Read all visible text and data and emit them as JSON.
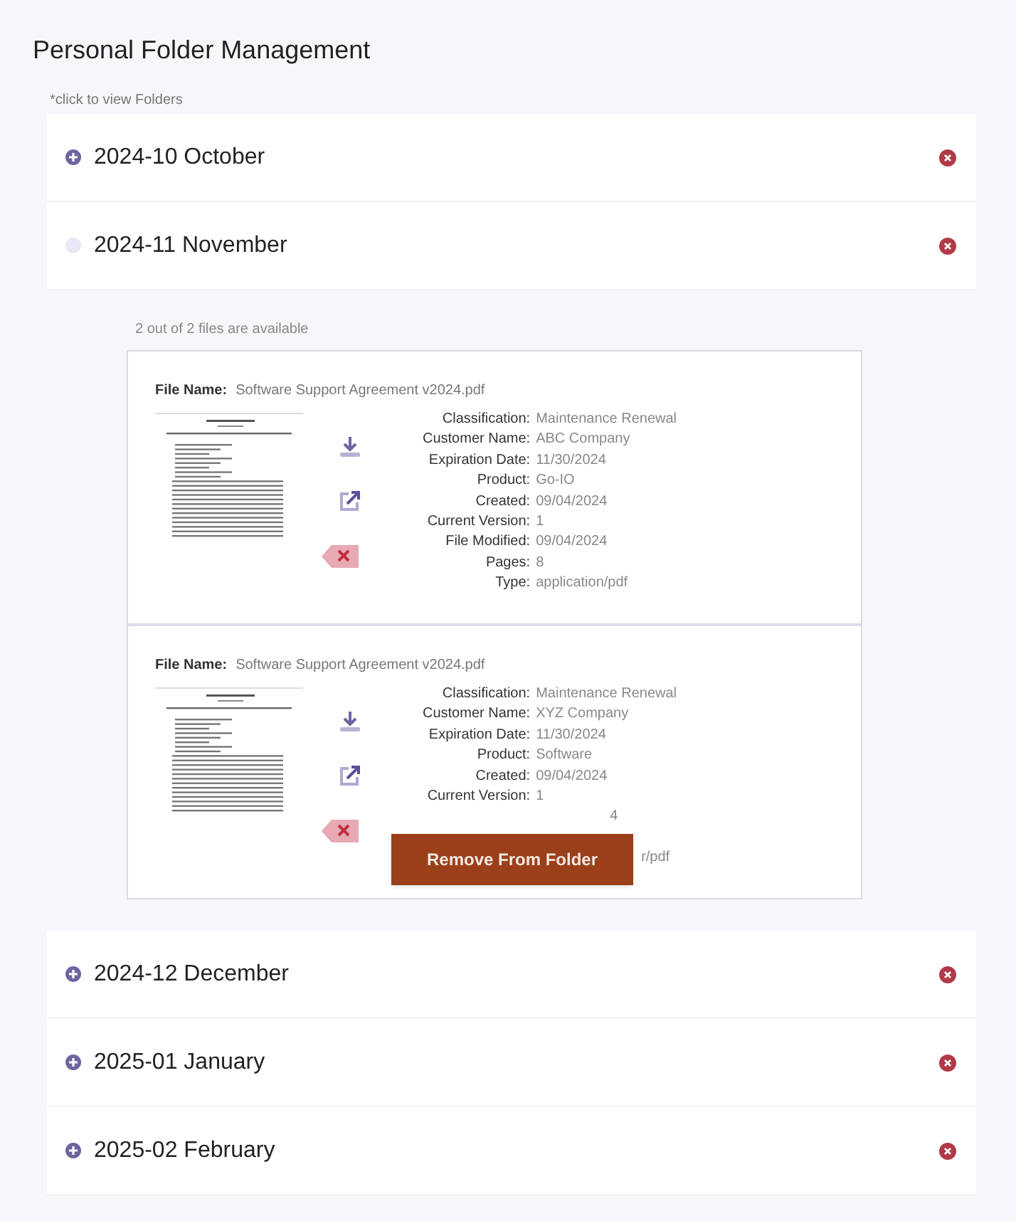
{
  "title": "Personal Folder Management",
  "hint": "*click to view Folders",
  "folders": [
    {
      "label": "2024-10 October",
      "expanded": false
    },
    {
      "label": "2024-11 November",
      "expanded": true,
      "availability": "2 out of 2 files are available",
      "files": [
        {
          "file_name_label": "File Name:",
          "file_name": "Software Support Agreement v2024.pdf",
          "details": [
            {
              "label": "Classification:",
              "value": "Maintenance Renewal"
            },
            {
              "label": "Customer Name:",
              "value": "ABC Company"
            },
            {
              "label": "Expiration Date:",
              "value": "11/30/2024"
            },
            {
              "label": "Product:",
              "value": "Go-IO"
            },
            {
              "label": "Created:",
              "value": "09/04/2024"
            },
            {
              "label": "Current Version:",
              "value": "1"
            },
            {
              "label": "File Modified:",
              "value": "09/04/2024"
            },
            {
              "label": "Pages:",
              "value": "8"
            },
            {
              "label": "Type:",
              "value": "application/pdf"
            }
          ]
        },
        {
          "file_name_label": "File Name:",
          "file_name": "Software Support Agreement v2024.pdf",
          "details": [
            {
              "label": "Classification:",
              "value": "Maintenance Renewal"
            },
            {
              "label": "Customer Name:",
              "value": "XYZ Company"
            },
            {
              "label": "Expiration Date:",
              "value": "11/30/2024"
            },
            {
              "label": "Product:",
              "value": "Software"
            },
            {
              "label": "Created:",
              "value": "09/04/2024"
            },
            {
              "label": "Current Version:",
              "value": "1"
            }
          ],
          "covered_fragments": [
            "4",
            "r/pdf"
          ],
          "tooltip": "Remove From Folder"
        }
      ]
    },
    {
      "label": "2024-12 December",
      "expanded": false
    },
    {
      "label": "2025-01 January",
      "expanded": false
    },
    {
      "label": "2025-02 February",
      "expanded": false
    }
  ]
}
